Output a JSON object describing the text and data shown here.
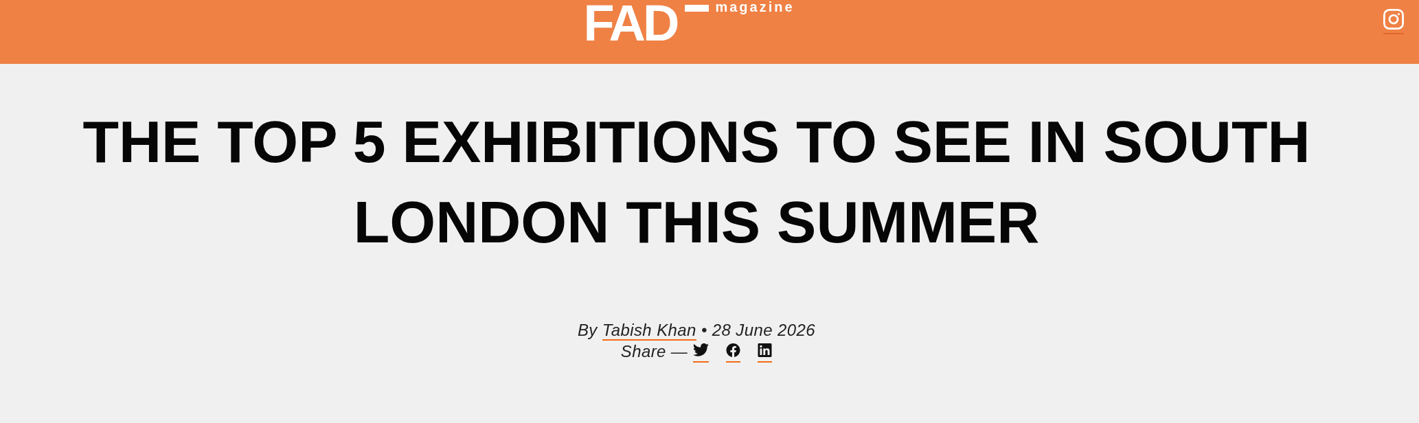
{
  "header": {
    "logo": {
      "wordmark": "FAD",
      "tagline": "magazine"
    },
    "social_links": [
      {
        "kind": "camera"
      }
    ]
  },
  "article": {
    "title": "THE TOP 5 EXHIBITIONS TO SEE IN SOUTH LONDON THIS SUMMER",
    "byline": {
      "prefix": "By",
      "author": "Tabish Khan",
      "separator": "•",
      "date": "28 June 2026"
    },
    "share": {
      "label": "Share —",
      "links": [
        {
          "kind": "bird"
        },
        {
          "kind": "f-circle"
        },
        {
          "kind": "in-square"
        }
      ]
    }
  }
}
